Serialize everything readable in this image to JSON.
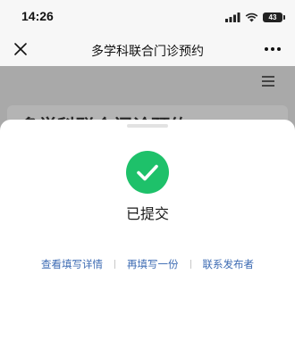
{
  "status_bar": {
    "time": "14:26",
    "battery": "43"
  },
  "nav": {
    "title": "多学科联合门诊预约"
  },
  "background_page": {
    "card_title": "多学科联合门诊预约"
  },
  "sheet": {
    "status_text": "已提交",
    "actions": [
      "查看填写详情",
      "再填写一份",
      "联系发布者"
    ]
  },
  "colors": {
    "success": "#1ec16a",
    "link": "#3d6bb3"
  }
}
